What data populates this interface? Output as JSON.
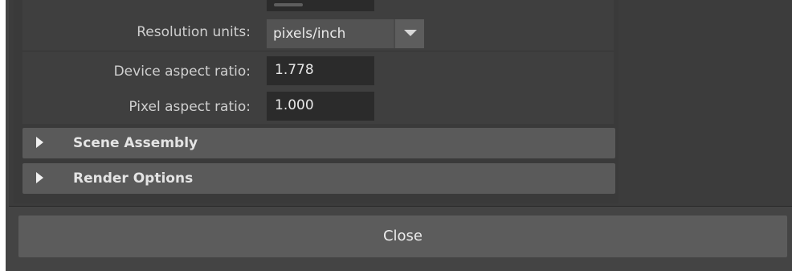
{
  "fields": {
    "resolution_units": {
      "label": "Resolution units:",
      "value": "pixels/inch"
    },
    "device_aspect_ratio": {
      "label": "Device aspect ratio:",
      "value": "1.778"
    },
    "pixel_aspect_ratio": {
      "label": "Pixel aspect ratio:",
      "value": "1.000"
    }
  },
  "sections": [
    {
      "title": "Scene Assembly",
      "expanded": false
    },
    {
      "title": "Render Options",
      "expanded": false
    }
  ],
  "footer": {
    "close_label": "Close"
  },
  "icons": {
    "dropdown_arrow": "chevron-down-icon",
    "section_toggle": "triangle-right-icon"
  },
  "colors": {
    "panel_bg": "#444444",
    "field_bg": "#2b2b2b",
    "section_header_bg": "#5a5a5a",
    "button_bg": "#5c5c5c",
    "text": "#cfcfcf"
  }
}
